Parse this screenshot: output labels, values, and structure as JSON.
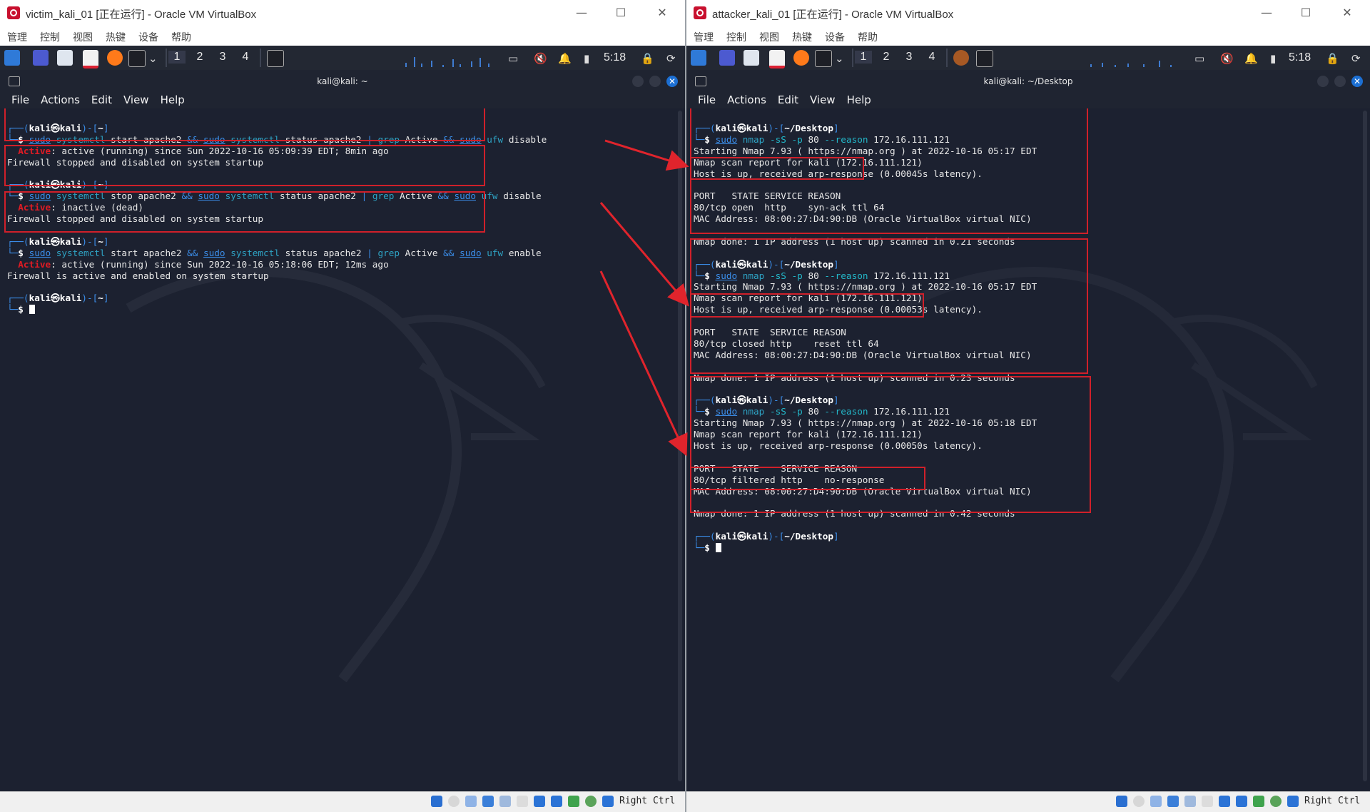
{
  "left": {
    "window_title": "victim_kali_01 [正在运行] - Oracle VM VirtualBox",
    "terminal_title": "kali@kali: ~",
    "user": "kali",
    "host": "kali",
    "cwd": "~",
    "blocks": [
      {
        "cmd_tokens": [
          {
            "t": "sudo",
            "c": "blue ul"
          },
          {
            "t": " "
          },
          {
            "t": "systemctl",
            "c": "green"
          },
          {
            "t": " start apache2 "
          },
          {
            "t": "&&",
            "c": "blue"
          },
          {
            "t": " "
          },
          {
            "t": "sudo",
            "c": "blue ul"
          },
          {
            "t": " "
          },
          {
            "t": "systemctl",
            "c": "green"
          },
          {
            "t": " status apache2 "
          },
          {
            "t": "|",
            "c": "blue"
          },
          {
            "t": " "
          },
          {
            "t": "grep",
            "c": "green"
          },
          {
            "t": " Active "
          },
          {
            "t": "&&",
            "c": "blue"
          },
          {
            "t": " "
          },
          {
            "t": "sudo",
            "c": "blue ul"
          },
          {
            "t": " "
          },
          {
            "t": "ufw",
            "c": "green"
          },
          {
            "t": " disable"
          }
        ],
        "output": [
          {
            "active": "Active",
            "rest": ": active (running) since Sun 2022-10-16 05:09:39 EDT; 8min ago"
          },
          {
            "text": "Firewall stopped and disabled on system startup"
          }
        ]
      },
      {
        "cmd_tokens": [
          {
            "t": "sudo",
            "c": "blue ul"
          },
          {
            "t": " "
          },
          {
            "t": "systemctl",
            "c": "green"
          },
          {
            "t": " stop apache2 "
          },
          {
            "t": "&&",
            "c": "blue"
          },
          {
            "t": " "
          },
          {
            "t": "sudo",
            "c": "blue ul"
          },
          {
            "t": " "
          },
          {
            "t": "systemctl",
            "c": "green"
          },
          {
            "t": " status apache2 "
          },
          {
            "t": "|",
            "c": "blue"
          },
          {
            "t": " "
          },
          {
            "t": "grep",
            "c": "green"
          },
          {
            "t": " Active "
          },
          {
            "t": "&&",
            "c": "blue"
          },
          {
            "t": " "
          },
          {
            "t": "sudo",
            "c": "blue ul"
          },
          {
            "t": " "
          },
          {
            "t": "ufw",
            "c": "green"
          },
          {
            "t": " disable"
          }
        ],
        "output": [
          {
            "active": "Active",
            "rest": ": inactive (dead)"
          },
          {
            "text": "Firewall stopped and disabled on system startup"
          }
        ]
      },
      {
        "cmd_tokens": [
          {
            "t": "sudo",
            "c": "blue ul"
          },
          {
            "t": " "
          },
          {
            "t": "systemctl",
            "c": "green"
          },
          {
            "t": " start apache2 "
          },
          {
            "t": "&&",
            "c": "blue"
          },
          {
            "t": " "
          },
          {
            "t": "sudo",
            "c": "blue ul"
          },
          {
            "t": " "
          },
          {
            "t": "systemctl",
            "c": "green"
          },
          {
            "t": " status apache2 "
          },
          {
            "t": "|",
            "c": "blue"
          },
          {
            "t": " "
          },
          {
            "t": "grep",
            "c": "green"
          },
          {
            "t": " Active "
          },
          {
            "t": "&&",
            "c": "blue"
          },
          {
            "t": " "
          },
          {
            "t": "sudo",
            "c": "blue ul"
          },
          {
            "t": " "
          },
          {
            "t": "ufw",
            "c": "green"
          },
          {
            "t": " enable"
          }
        ],
        "output": [
          {
            "active": "Active",
            "rest": ": active (running) since Sun 2022-10-16 05:18:06 EDT; 12ms ago"
          },
          {
            "text": "Firewall is active and enabled on system startup"
          }
        ]
      }
    ]
  },
  "right": {
    "window_title": "attacker_kali_01 [正在运行] - Oracle VM VirtualBox",
    "terminal_title": "kali@kali: ~/Desktop",
    "user": "kali",
    "host": "kali",
    "cwd": "~/Desktop",
    "cmd_tokens": [
      {
        "t": "sudo",
        "c": "blue ul"
      },
      {
        "t": " "
      },
      {
        "t": "nmap",
        "c": "green"
      },
      {
        "t": " "
      },
      {
        "t": "-sS",
        "c": "cyan"
      },
      {
        "t": " "
      },
      {
        "t": "-p",
        "c": "cyan"
      },
      {
        "t": " 80 "
      },
      {
        "t": "--reason",
        "c": "cyan"
      },
      {
        "t": " 172.16.111.121"
      }
    ],
    "blocks": [
      {
        "lines": [
          "Starting Nmap 7.93 ( https://nmap.org ) at 2022-10-16 05:17 EDT",
          "Nmap scan report for kali (172.16.111.121)",
          "Host is up, received arp-response (0.00045s latency).",
          "",
          "PORT   STATE SERVICE REASON",
          "80/tcp open  http    syn-ack ttl 64",
          "MAC Address: 08:00:27:D4:90:DB (Oracle VirtualBox virtual NIC)",
          "",
          "Nmap done: 1 IP address (1 host up) scanned in 0.21 seconds"
        ]
      },
      {
        "lines": [
          "Starting Nmap 7.93 ( https://nmap.org ) at 2022-10-16 05:17 EDT",
          "Nmap scan report for kali (172.16.111.121)",
          "Host is up, received arp-response (0.00053s latency).",
          "",
          "PORT   STATE  SERVICE REASON",
          "80/tcp closed http    reset ttl 64",
          "MAC Address: 08:00:27:D4:90:DB (Oracle VirtualBox virtual NIC)",
          "",
          "Nmap done: 1 IP address (1 host up) scanned in 0.23 seconds"
        ]
      },
      {
        "lines": [
          "Starting Nmap 7.93 ( https://nmap.org ) at 2022-10-16 05:18 EDT",
          "Nmap scan report for kali (172.16.111.121)",
          "Host is up, received arp-response (0.00050s latency).",
          "",
          "PORT   STATE    SERVICE REASON",
          "80/tcp filtered http    no-response",
          "MAC Address: 08:00:27:D4:90:DB (Oracle VirtualBox virtual NIC)",
          "",
          "Nmap done: 1 IP address (1 host up) scanned in 0.42 seconds"
        ]
      }
    ]
  },
  "host_menu": [
    "管理",
    "控制",
    "视图",
    "热键",
    "设备",
    "帮助"
  ],
  "terminal_menu": [
    "File",
    "Actions",
    "Edit",
    "View",
    "Help"
  ],
  "workspaces": [
    "1",
    "2",
    "3",
    "4"
  ],
  "clock": "5:18",
  "host_key": "Right Ctrl",
  "window_controls": {
    "minimize": "—",
    "maximize": "☐",
    "close": "✕"
  },
  "colors": {
    "kali_blue": "#3b8eea",
    "active_red": "#e01b24",
    "annotation_red": "#d0202a",
    "terminal_bg": "#1c2130"
  }
}
